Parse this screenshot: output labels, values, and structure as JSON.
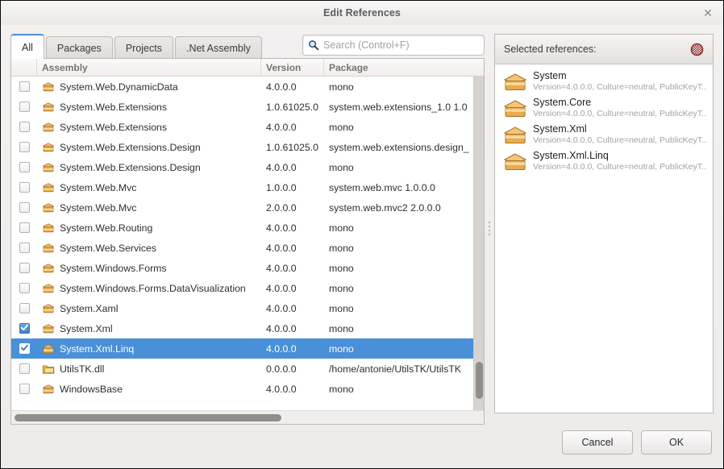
{
  "window": {
    "title": "Edit References",
    "close_label": "✕"
  },
  "tabs": [
    {
      "label": "All",
      "active": true
    },
    {
      "label": "Packages",
      "active": false
    },
    {
      "label": "Projects",
      "active": false
    },
    {
      "label": ".Net Assembly",
      "active": false
    }
  ],
  "search": {
    "placeholder": "Search (Control+F)",
    "value": "",
    "icon": "search-icon"
  },
  "table": {
    "columns": [
      "",
      "Assembly",
      "Version",
      "Package"
    ],
    "rows": [
      {
        "checked": false,
        "selected": false,
        "icon": "assembly-icon",
        "assembly": "System.Web.DynamicData",
        "version": "4.0.0.0",
        "package": "mono"
      },
      {
        "checked": false,
        "selected": false,
        "icon": "assembly-icon",
        "assembly": "System.Web.Extensions",
        "version": "1.0.61025.0",
        "package": "system.web.extensions_1.0 1.0"
      },
      {
        "checked": false,
        "selected": false,
        "icon": "assembly-icon",
        "assembly": "System.Web.Extensions",
        "version": "4.0.0.0",
        "package": "mono"
      },
      {
        "checked": false,
        "selected": false,
        "icon": "assembly-icon",
        "assembly": "System.Web.Extensions.Design",
        "version": "1.0.61025.0",
        "package": "system.web.extensions.design_"
      },
      {
        "checked": false,
        "selected": false,
        "icon": "assembly-icon",
        "assembly": "System.Web.Extensions.Design",
        "version": "4.0.0.0",
        "package": "mono"
      },
      {
        "checked": false,
        "selected": false,
        "icon": "assembly-icon",
        "assembly": "System.Web.Mvc",
        "version": "1.0.0.0",
        "package": "system.web.mvc 1.0.0.0"
      },
      {
        "checked": false,
        "selected": false,
        "icon": "assembly-icon",
        "assembly": "System.Web.Mvc",
        "version": "2.0.0.0",
        "package": "system.web.mvc2 2.0.0.0"
      },
      {
        "checked": false,
        "selected": false,
        "icon": "assembly-icon",
        "assembly": "System.Web.Routing",
        "version": "4.0.0.0",
        "package": "mono"
      },
      {
        "checked": false,
        "selected": false,
        "icon": "assembly-icon",
        "assembly": "System.Web.Services",
        "version": "4.0.0.0",
        "package": "mono"
      },
      {
        "checked": false,
        "selected": false,
        "icon": "assembly-icon",
        "assembly": "System.Windows.Forms",
        "version": "4.0.0.0",
        "package": "mono"
      },
      {
        "checked": false,
        "selected": false,
        "icon": "assembly-icon",
        "assembly": "System.Windows.Forms.DataVisualization",
        "version": "4.0.0.0",
        "package": "mono"
      },
      {
        "checked": false,
        "selected": false,
        "icon": "assembly-icon",
        "assembly": "System.Xaml",
        "version": "4.0.0.0",
        "package": "mono"
      },
      {
        "checked": true,
        "selected": false,
        "icon": "assembly-icon",
        "assembly": "System.Xml",
        "version": "4.0.0.0",
        "package": "mono"
      },
      {
        "checked": true,
        "selected": true,
        "icon": "assembly-icon",
        "assembly": "System.Xml.Linq",
        "version": "4.0.0.0",
        "package": "mono"
      },
      {
        "checked": false,
        "selected": false,
        "icon": "folder-icon",
        "assembly": "UtilsTK.dll",
        "version": "0.0.0.0",
        "package": "/home/antonie/UtilsTK/UtilsTK"
      },
      {
        "checked": false,
        "selected": false,
        "icon": "assembly-icon",
        "assembly": "WindowsBase",
        "version": "4.0.0.0",
        "package": "mono"
      }
    ]
  },
  "selected_panel": {
    "title": "Selected references:",
    "clear_icon": "clear-all-icon",
    "items": [
      {
        "name": "System",
        "details": "Version=4.0.0.0, Culture=neutral, PublicKeyT..."
      },
      {
        "name": "System.Core",
        "details": "Version=4.0.0.0, Culture=neutral, PublicKeyT..."
      },
      {
        "name": "System.Xml",
        "details": "Version=4.0.0.0, Culture=neutral, PublicKeyT..."
      },
      {
        "name": "System.Xml.Linq",
        "details": "Version=4.0.0.0, Culture=neutral, PublicKeyT..."
      }
    ]
  },
  "footer": {
    "cancel_label": "Cancel",
    "ok_label": "OK"
  },
  "colors": {
    "selection_blue": "#4a90d9",
    "accent_tab": "#4a90d9",
    "clear_red": "#8c2b2b",
    "assembly_icon": "#e0a33c"
  }
}
